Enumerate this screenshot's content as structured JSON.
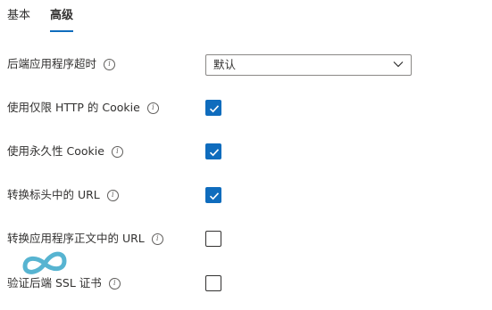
{
  "tabs": [
    {
      "label": "基本",
      "active": false
    },
    {
      "label": "高级",
      "active": true
    }
  ],
  "settings": {
    "timeout": {
      "label": "后端应用程序超时",
      "value": "默认"
    },
    "http_only_cookie": {
      "label": "使用仅限 HTTP 的 Cookie",
      "checked": true
    },
    "persistent_cookie": {
      "label": "使用永久性 Cookie",
      "checked": true
    },
    "translate_header_url": {
      "label": "转换标头中的 URL",
      "checked": true
    },
    "translate_body_url": {
      "label": "转换应用程序正文中的 URL",
      "checked": false
    },
    "validate_backend_ssl": {
      "label": "验证后端 SSL 证书",
      "checked": false
    }
  },
  "icons": {
    "info": "info-icon",
    "checkmark": "checkmark-icon",
    "chevron": "chevron-down-icon",
    "watermark": "infinity-logo-icon"
  },
  "colors": {
    "accent": "#0f6cbd",
    "text": "#323130",
    "watermark": "#3aa8c9"
  }
}
